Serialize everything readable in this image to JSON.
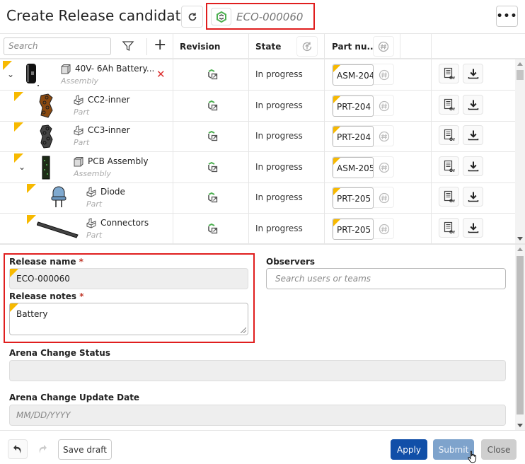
{
  "header": {
    "title": "Create Release candidate",
    "eco_id": "ECO-000060",
    "icons": {
      "refresh": "refresh-icon",
      "eco": "arena-logo-icon",
      "more": "more-icon"
    },
    "more_label": "•••"
  },
  "table": {
    "search_placeholder": "Search",
    "add_label": "+",
    "columns": {
      "revision": "Revision",
      "state": "State",
      "part_number": "Part nu..."
    },
    "rows": [
      {
        "name": "40V- 6Ah Battery...",
        "type": "Assembly",
        "level": 0,
        "expandable": true,
        "removable": true,
        "state": "In progress",
        "part_number": "ASM-204",
        "thumb": "battery"
      },
      {
        "name": "CC2-inner",
        "type": "Part",
        "level": 1,
        "expandable": false,
        "removable": false,
        "state": "In progress",
        "part_number": "PRT-204",
        "thumb": "cc2"
      },
      {
        "name": "CC3-inner",
        "type": "Part",
        "level": 1,
        "expandable": false,
        "removable": false,
        "state": "In progress",
        "part_number": "PRT-204",
        "thumb": "cc3"
      },
      {
        "name": "PCB Assembly",
        "type": "Assembly",
        "level": 1,
        "expandable": true,
        "removable": false,
        "state": "In progress",
        "part_number": "ASM-205",
        "thumb": "pcb"
      },
      {
        "name": "Diode",
        "type": "Part",
        "level": 2,
        "expandable": false,
        "removable": false,
        "state": "In progress",
        "part_number": "PRT-205",
        "thumb": "diode"
      },
      {
        "name": "Connectors",
        "type": "Part",
        "level": 2,
        "expandable": false,
        "removable": false,
        "state": "In progress",
        "part_number": "PRT-205",
        "thumb": "connector"
      }
    ]
  },
  "form": {
    "release_name_label": "Release name",
    "release_name_value": "ECO-000060",
    "release_notes_label": "Release notes",
    "release_notes_value": "Battery",
    "required_mark": "*",
    "observers_label": "Observers",
    "observers_placeholder": "Search users or teams",
    "arena_status_label": "Arena Change Status",
    "arena_status_value": "",
    "arena_date_label": "Arena Change Update Date",
    "arena_date_placeholder": "MM/DD/YYYY"
  },
  "footer": {
    "save_draft": "Save draft",
    "apply": "Apply",
    "submit": "Submit",
    "close": "Close"
  },
  "colors": {
    "accent_blue": "#114fa8",
    "submit_disabled": "#7ea3cc",
    "highlight_red": "#e01e1e",
    "flag_yellow": "#f7b900",
    "revision_green": "#4caf50",
    "remove_red": "#d33333"
  }
}
